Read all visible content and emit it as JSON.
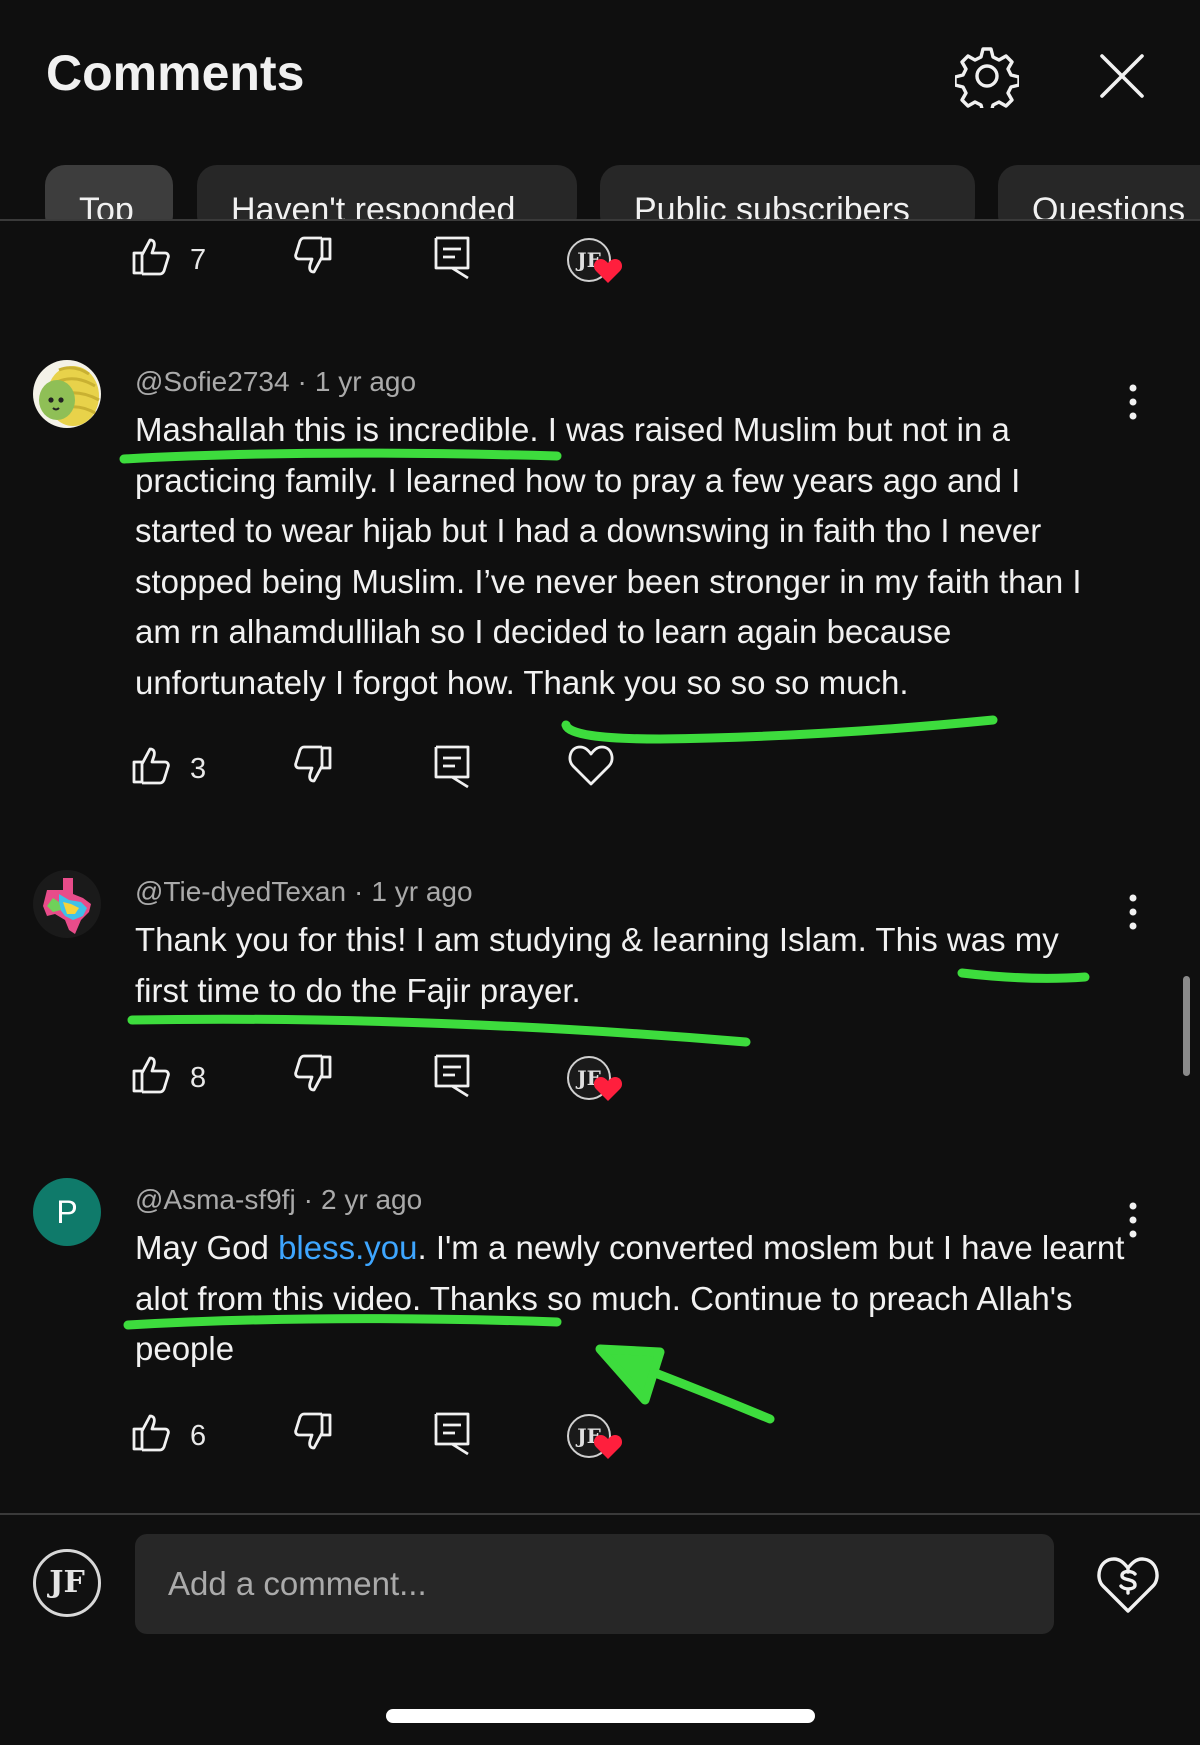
{
  "header": {
    "title": "Comments"
  },
  "chips": [
    {
      "label": "Top",
      "active": true
    },
    {
      "label": "Haven't responded"
    },
    {
      "label": "Public subscribers"
    },
    {
      "label": "Questions"
    }
  ],
  "previous_comment": {
    "likes": "7",
    "creator_heart": true
  },
  "comments": [
    {
      "author": "@Sofie2734",
      "time": "1 yr ago",
      "text": "Mashallah this is incredible. I was raised Muslim but not in a practicing family. I learned how to pray a few years ago and I started to wear hijab but I had a downswing in faith tho I never stopped being Muslim. I’ve never been stronger in my faith than I am rn alhamdullilah so I decided to learn again because unfortunately I forgot how. Thank you so so so much.",
      "likes": "3",
      "creator_heart": false
    },
    {
      "author": "@Tie-dyedTexan",
      "time": "1 yr ago",
      "text": "Thank you for this! I am studying & learning Islam. This was my first time to do the Fajir prayer.",
      "likes": "8",
      "creator_heart": true
    },
    {
      "author": "@Asma-sf9fj",
      "time": "2 yr ago",
      "avatar_letter": "P",
      "text_before_link": "May God ",
      "link_text": "bless.you",
      "text_after_link": ".  I'm a newly converted moslem but I have learnt alot from this video. Thanks so much. Continue to preach Allah's people",
      "likes": "6",
      "creator_heart": true
    }
  ],
  "creator_initials": "JF",
  "composer": {
    "placeholder": "Add a comment..."
  },
  "colors": {
    "highlight": "#3ddc3d",
    "link": "#3ea6ff",
    "avatar_p": "#0f7a6a",
    "heart": "#ff1f3d"
  }
}
